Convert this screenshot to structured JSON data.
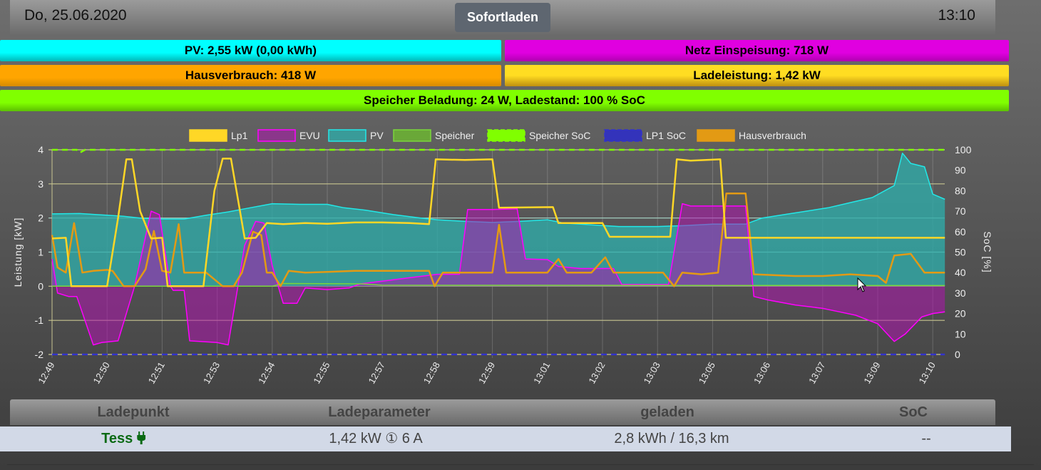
{
  "header": {
    "date": "Do, 25.06.2020",
    "time": "13:10",
    "mode_button": "Sofortladen"
  },
  "status": {
    "pv": "PV: 2,55 kW (0,00 kWh)",
    "grid": "Netz Einspeisung: 718 W",
    "house": "Hausverbrauch: 418 W",
    "charge": "Ladeleistung: 1,42 kW",
    "storage": "Speicher Beladung: 24 W, Ladestand: 100 % SoC",
    "colors": {
      "pv": "#00ffff",
      "grid": "#e000e0",
      "house": "#ffa500",
      "charge": "#ffdd22",
      "storage": "#80ff00"
    }
  },
  "chart_data": {
    "type": "line",
    "ylabel": "Leistung [kW]",
    "y2label": "SoC [%]",
    "ylim": [
      -2,
      4
    ],
    "y2lim": [
      0,
      100
    ],
    "yticks": [
      "4",
      "3",
      "2",
      "1",
      "0",
      "-1",
      "-2"
    ],
    "y2ticks": [
      "100",
      "90",
      "80",
      "70",
      "60",
      "50",
      "40",
      "30",
      "20",
      "10",
      "0"
    ],
    "categories": [
      "12:49",
      "12:50",
      "12:51",
      "12:53",
      "12:54",
      "12:55",
      "12:57",
      "12:58",
      "12:59",
      "13:01",
      "13:02",
      "13:03",
      "13:05",
      "13:06",
      "13:07",
      "13:09",
      "13:10"
    ],
    "x_max_index": 16.22,
    "legend_position": "top",
    "series": [
      {
        "name": "Lp1",
        "axis": "left",
        "color": "#ffd726",
        "fill": "none",
        "points": [
          [
            0,
            1.4
          ],
          [
            0.25,
            1.42
          ],
          [
            0.35,
            0
          ],
          [
            1.0,
            0
          ],
          [
            1.2,
            2.0
          ],
          [
            1.35,
            3.72
          ],
          [
            1.45,
            3.72
          ],
          [
            1.6,
            2.2
          ],
          [
            1.8,
            1.4
          ],
          [
            2.0,
            1.42
          ],
          [
            2.1,
            0
          ],
          [
            2.75,
            0
          ],
          [
            2.95,
            2.8
          ],
          [
            3.1,
            3.74
          ],
          [
            3.25,
            3.74
          ],
          [
            3.5,
            1.4
          ],
          [
            3.7,
            1.42
          ],
          [
            3.9,
            1.85
          ],
          [
            4.2,
            1.82
          ],
          [
            4.6,
            1.85
          ],
          [
            5.0,
            1.83
          ],
          [
            5.5,
            1.87
          ],
          [
            6.0,
            1.87
          ],
          [
            6.5,
            1.85
          ],
          [
            6.85,
            1.82
          ],
          [
            6.97,
            3.72
          ],
          [
            7.5,
            3.7
          ],
          [
            8.0,
            3.72
          ],
          [
            8.12,
            2.3
          ],
          [
            9.1,
            2.32
          ],
          [
            9.2,
            1.85
          ],
          [
            10.0,
            1.85
          ],
          [
            10.13,
            1.45
          ],
          [
            11.23,
            1.45
          ],
          [
            11.35,
            3.72
          ],
          [
            11.6,
            3.68
          ],
          [
            12.14,
            3.72
          ],
          [
            12.24,
            1.42
          ],
          [
            16.22,
            1.42
          ]
        ]
      },
      {
        "name": "EVU",
        "axis": "left",
        "color": "#ff00ff",
        "fill": "rgba(175,20,175,0.55)",
        "points": [
          [
            0,
            0.8
          ],
          [
            0.1,
            -0.2
          ],
          [
            0.3,
            -0.3
          ],
          [
            0.45,
            -0.3
          ],
          [
            0.75,
            -1.72
          ],
          [
            0.9,
            -1.65
          ],
          [
            1.2,
            -1.6
          ],
          [
            1.5,
            0
          ],
          [
            1.8,
            2.2
          ],
          [
            1.95,
            2.1
          ],
          [
            2.15,
            0
          ],
          [
            2.2,
            -0.12
          ],
          [
            2.4,
            -0.12
          ],
          [
            2.5,
            -1.6
          ],
          [
            3.0,
            -1.65
          ],
          [
            3.2,
            -1.72
          ],
          [
            3.5,
            1.2
          ],
          [
            3.7,
            1.9
          ],
          [
            3.85,
            1.85
          ],
          [
            4.0,
            0.6
          ],
          [
            4.2,
            -0.5
          ],
          [
            4.45,
            -0.5
          ],
          [
            4.6,
            -0.05
          ],
          [
            5.0,
            -0.1
          ],
          [
            5.4,
            -0.05
          ],
          [
            5.6,
            0.07
          ],
          [
            6.0,
            0.15
          ],
          [
            6.5,
            0.25
          ],
          [
            7.0,
            0.35
          ],
          [
            7.4,
            0.35
          ],
          [
            7.55,
            2.25
          ],
          [
            8.0,
            2.25
          ],
          [
            8.45,
            2.27
          ],
          [
            8.6,
            0.8
          ],
          [
            9.0,
            0.78
          ],
          [
            9.2,
            0.58
          ],
          [
            9.6,
            0.52
          ],
          [
            10.2,
            0.52
          ],
          [
            10.35,
            0.05
          ],
          [
            11.2,
            0.05
          ],
          [
            11.45,
            2.42
          ],
          [
            11.6,
            2.35
          ],
          [
            12.0,
            2.35
          ],
          [
            12.6,
            2.35
          ],
          [
            12.75,
            -0.3
          ],
          [
            13.0,
            -0.4
          ],
          [
            13.5,
            -0.55
          ],
          [
            14.0,
            -0.65
          ],
          [
            14.3,
            -0.75
          ],
          [
            14.6,
            -0.85
          ],
          [
            15.0,
            -1.1
          ],
          [
            15.3,
            -1.62
          ],
          [
            15.5,
            -1.4
          ],
          [
            15.8,
            -0.9
          ],
          [
            16.0,
            -0.8
          ],
          [
            16.22,
            -0.75
          ]
        ]
      },
      {
        "name": "PV",
        "axis": "left",
        "color": "#22e8e8",
        "fill": "rgba(48,170,168,0.8)",
        "points": [
          [
            0,
            2.12
          ],
          [
            0.5,
            2.13
          ],
          [
            1.0,
            2.08
          ],
          [
            1.3,
            2.05
          ],
          [
            1.6,
            2.0
          ],
          [
            2.0,
            1.97
          ],
          [
            2.4,
            1.97
          ],
          [
            2.8,
            2.08
          ],
          [
            3.2,
            2.18
          ],
          [
            3.6,
            2.3
          ],
          [
            4.0,
            2.42
          ],
          [
            4.5,
            2.4
          ],
          [
            5.0,
            2.4
          ],
          [
            5.3,
            2.3
          ],
          [
            5.7,
            2.23
          ],
          [
            6.2,
            2.1
          ],
          [
            6.7,
            2.0
          ],
          [
            7.0,
            1.95
          ],
          [
            7.5,
            1.9
          ],
          [
            8.0,
            1.87
          ],
          [
            8.5,
            1.9
          ],
          [
            9.0,
            1.95
          ],
          [
            9.3,
            1.85
          ],
          [
            9.8,
            1.8
          ],
          [
            10.3,
            1.75
          ],
          [
            11.0,
            1.75
          ],
          [
            11.5,
            1.78
          ],
          [
            12.0,
            1.82
          ],
          [
            12.6,
            1.82
          ],
          [
            12.9,
            2.0
          ],
          [
            13.3,
            2.1
          ],
          [
            13.7,
            2.2
          ],
          [
            14.1,
            2.3
          ],
          [
            14.5,
            2.45
          ],
          [
            14.9,
            2.6
          ],
          [
            15.3,
            2.95
          ],
          [
            15.45,
            3.9
          ],
          [
            15.6,
            3.6
          ],
          [
            15.85,
            3.5
          ],
          [
            16.0,
            2.7
          ],
          [
            16.22,
            2.55
          ]
        ]
      },
      {
        "name": "Speicher",
        "axis": "left",
        "color": "#7ad63a",
        "fill": "none",
        "points": [
          [
            0,
            0
          ],
          [
            4.0,
            0
          ],
          [
            4.2,
            0.08
          ],
          [
            5.6,
            0.07
          ],
          [
            6.0,
            0.03
          ],
          [
            16.22,
            0.02
          ]
        ]
      },
      {
        "name": "Speicher SoC",
        "axis": "right",
        "color": "#80ff00",
        "dashed": true,
        "fill": "none",
        "points": [
          [
            0,
            100
          ],
          [
            0.45,
            100
          ],
          [
            0.5,
            98.5
          ],
          [
            0.6,
            100
          ],
          [
            16.22,
            100
          ]
        ]
      },
      {
        "name": "LP1 SoC",
        "axis": "right",
        "color": "#3333cc",
        "dashed": true,
        "fill": "none",
        "points": [
          [
            0,
            0
          ],
          [
            16.22,
            0
          ]
        ]
      },
      {
        "name": "Hausverbrauch",
        "axis": "left",
        "color": "#e39a14",
        "fill": "none",
        "points": [
          [
            0,
            1.5
          ],
          [
            0.1,
            0.55
          ],
          [
            0.25,
            0.4
          ],
          [
            0.4,
            1.85
          ],
          [
            0.55,
            0.4
          ],
          [
            0.75,
            0.45
          ],
          [
            1.0,
            0.48
          ],
          [
            1.1,
            0.45
          ],
          [
            1.3,
            0
          ],
          [
            1.5,
            0
          ],
          [
            1.7,
            0.5
          ],
          [
            1.85,
            1.62
          ],
          [
            2.0,
            0.45
          ],
          [
            2.15,
            0.4
          ],
          [
            2.3,
            1.82
          ],
          [
            2.4,
            0.4
          ],
          [
            2.8,
            0.4
          ],
          [
            3.1,
            0
          ],
          [
            3.3,
            0
          ],
          [
            3.45,
            0.4
          ],
          [
            3.65,
            1.6
          ],
          [
            3.8,
            1.5
          ],
          [
            3.9,
            0.4
          ],
          [
            4.0,
            0.4
          ],
          [
            4.15,
            0
          ],
          [
            4.3,
            0.45
          ],
          [
            4.6,
            0.4
          ],
          [
            5.0,
            0.42
          ],
          [
            5.5,
            0.45
          ],
          [
            6.0,
            0.45
          ],
          [
            6.5,
            0.45
          ],
          [
            6.85,
            0.45
          ],
          [
            6.95,
            0
          ],
          [
            7.1,
            0.4
          ],
          [
            8.0,
            0.4
          ],
          [
            8.12,
            1.8
          ],
          [
            8.25,
            0.4
          ],
          [
            9.0,
            0.4
          ],
          [
            9.2,
            0.8
          ],
          [
            9.35,
            0.4
          ],
          [
            9.8,
            0.4
          ],
          [
            10.05,
            0.85
          ],
          [
            10.2,
            0.4
          ],
          [
            11.1,
            0.4
          ],
          [
            11.3,
            0
          ],
          [
            11.45,
            0.4
          ],
          [
            11.8,
            0.35
          ],
          [
            12.1,
            0.4
          ],
          [
            12.25,
            2.72
          ],
          [
            12.6,
            2.72
          ],
          [
            12.75,
            0.35
          ],
          [
            13.5,
            0.3
          ],
          [
            14.0,
            0.3
          ],
          [
            14.5,
            0.35
          ],
          [
            15.0,
            0.3
          ],
          [
            15.15,
            0.1
          ],
          [
            15.3,
            0.9
          ],
          [
            15.6,
            0.95
          ],
          [
            15.85,
            0.4
          ],
          [
            16.22,
            0.4
          ]
        ]
      }
    ]
  },
  "table": {
    "headers": [
      "Ladepunkt",
      "Ladeparameter",
      "geladen",
      "SoC"
    ],
    "row": {
      "name": "Tess",
      "params": "1,42 kW ① 6 A",
      "charged": "2,8 kWh / 16,3 km",
      "soc": "--"
    }
  }
}
